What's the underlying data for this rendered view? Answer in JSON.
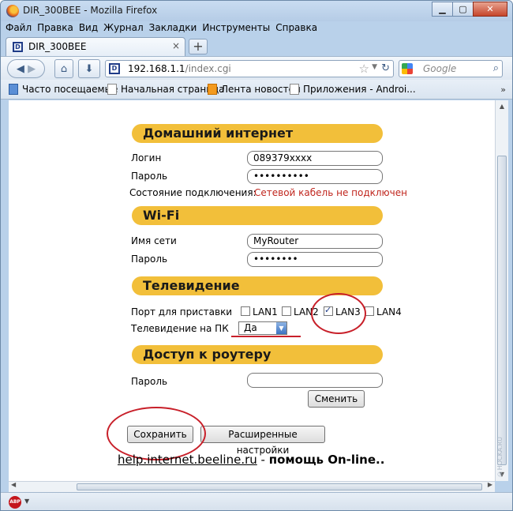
{
  "window": {
    "title": "DIR_300BEE - Mozilla Firefox"
  },
  "menu": [
    "Файл",
    "Правка",
    "Вид",
    "Журнал",
    "Закладки",
    "Инструменты",
    "Справка"
  ],
  "tab": {
    "title": "DIR_300BEE",
    "close": "×",
    "new_tab": "+"
  },
  "address": {
    "host": "192.168.1.1",
    "path": "/index.cgi"
  },
  "search": {
    "placeholder": "Google"
  },
  "bookmarks": [
    "Часто посещаемые",
    "Начальная страница",
    "Лента новостей",
    "Приложения - Androi..."
  ],
  "sections": {
    "internet": {
      "title": "Домашний интернет",
      "login_label": "Логин",
      "login_value": "089379xxxx",
      "password_label": "Пароль",
      "password_value": "••••••••••",
      "status_label": "Состояние подключения:",
      "status_value": "Сетевой кабель не подключен"
    },
    "wifi": {
      "title": "Wi-Fi",
      "ssid_label": "Имя сети",
      "ssid_value": "MyRouter",
      "password_label": "Пароль",
      "password_value": "••••••••"
    },
    "tv": {
      "title": "Телевидение",
      "port_label": "Порт для приставки",
      "ports": [
        {
          "label": "LAN1",
          "checked": false
        },
        {
          "label": "LAN2",
          "checked": false
        },
        {
          "label": "LAN3",
          "checked": true
        },
        {
          "label": "LAN4",
          "checked": false
        }
      ],
      "pc_label": "Телевидение на ПК",
      "pc_value": "Да"
    },
    "access": {
      "title": "Доступ к роутеру",
      "password_label": "Пароль",
      "password_value": "",
      "change_button": "Сменить"
    }
  },
  "buttons": {
    "save": "Сохранить",
    "advanced": "Расширенные настройки"
  },
  "help": {
    "link": "help.internet.beeline.ru",
    "dash": " - ",
    "text": "помощь On-line",
    "suffix": ".."
  },
  "watermark": "©HOCKA.RU",
  "annotation_color": "#c8202a",
  "section_color": "#f2bf3a"
}
